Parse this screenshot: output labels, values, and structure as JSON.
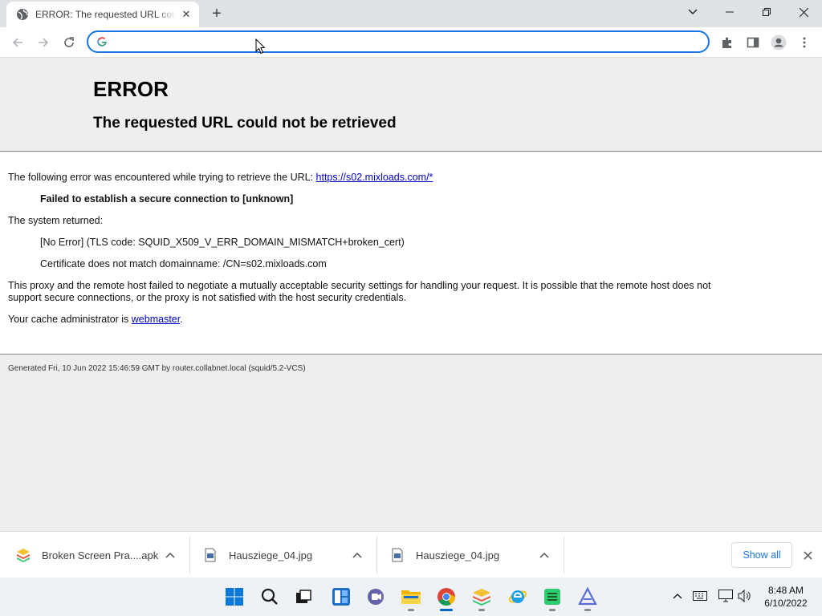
{
  "browser": {
    "tab_title": "ERROR: The requested URL could not be retrieved",
    "omnibox_value": ""
  },
  "page": {
    "heading": "ERROR",
    "subheading": "The requested URL could not be retrieved",
    "intro_text": "The following error was encountered while trying to retrieve the URL: ",
    "url_link": "https://s02.mixloads.com/*",
    "error_message": "Failed to establish a secure connection to [unknown]",
    "system_returned_label": "The system returned:",
    "system_error": "[No Error] (TLS code: SQUID_X509_V_ERR_DOMAIN_MISMATCH+broken_cert)",
    "certificate_msg": "Certificate does not match domainname: /CN=s02.mixloads.com",
    "explanation_line1": "This proxy and the remote host failed to negotiate a mutually acceptable security settings for handling your request. It is possible that the remote host does not",
    "explanation_line2": "support secure connections, or the proxy is not satisfied with the host security credentials.",
    "cache_admin_text": "Your cache administrator is ",
    "webmaster_link": "webmaster",
    "cache_admin_suffix": ".",
    "generated": "Generated Fri, 10 Jun 2022 15:46:59 GMT by router.collabnet.local (squid/5.2-VCS)"
  },
  "downloads": {
    "items": [
      {
        "name": "Broken Screen Pra....apk",
        "icon": "bluestacks-apk-icon"
      },
      {
        "name": "Hausziege_04.jpg",
        "icon": "image-file-icon"
      },
      {
        "name": "Hausziege_04.jpg",
        "icon": "image-file-icon"
      }
    ],
    "show_all": "Show all"
  },
  "taskbar": {
    "time": "8:48 AM",
    "date": "6/10/2022"
  },
  "colors": {
    "accent": "#1a73e8",
    "link": "#0000cc",
    "taskbar_active": "#0067c0"
  }
}
